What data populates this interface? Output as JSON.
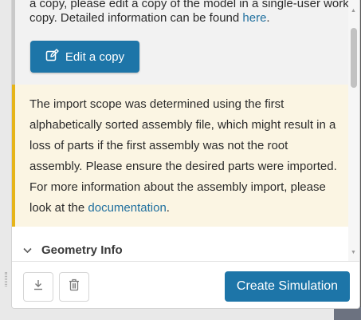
{
  "info": {
    "truncated_line": "a copy, please edit a copy of the model in a single-user workspace.",
    "text_before_link": "copy. Detailed information can be found ",
    "link_text": "here",
    "text_after_link": ".",
    "edit_button_label": "Edit a copy",
    "edit_icon": "edit-pencil-icon"
  },
  "warning": {
    "text_before_link": "The import scope was determined using the first alphabetically sorted assembly file, which might result in a loss of parts if the first assembly was not the root assembly. Please ensure the desired parts were imported. For more information about the assembly import, please look at the ",
    "link_text": "documentation",
    "text_after_link": "."
  },
  "geometry": {
    "label": "Geometry Info",
    "chevron_icon": "chevron-down-icon"
  },
  "footer": {
    "download_icon": "download-icon",
    "delete_icon": "trash-icon",
    "create_label": "Create Simulation"
  },
  "colors": {
    "primary": "#1d75a8",
    "warning_accent": "#e6b418",
    "warning_bg": "#fbf5e3",
    "info_bg": "#f2f2f2",
    "link": "#1f6f9e"
  }
}
